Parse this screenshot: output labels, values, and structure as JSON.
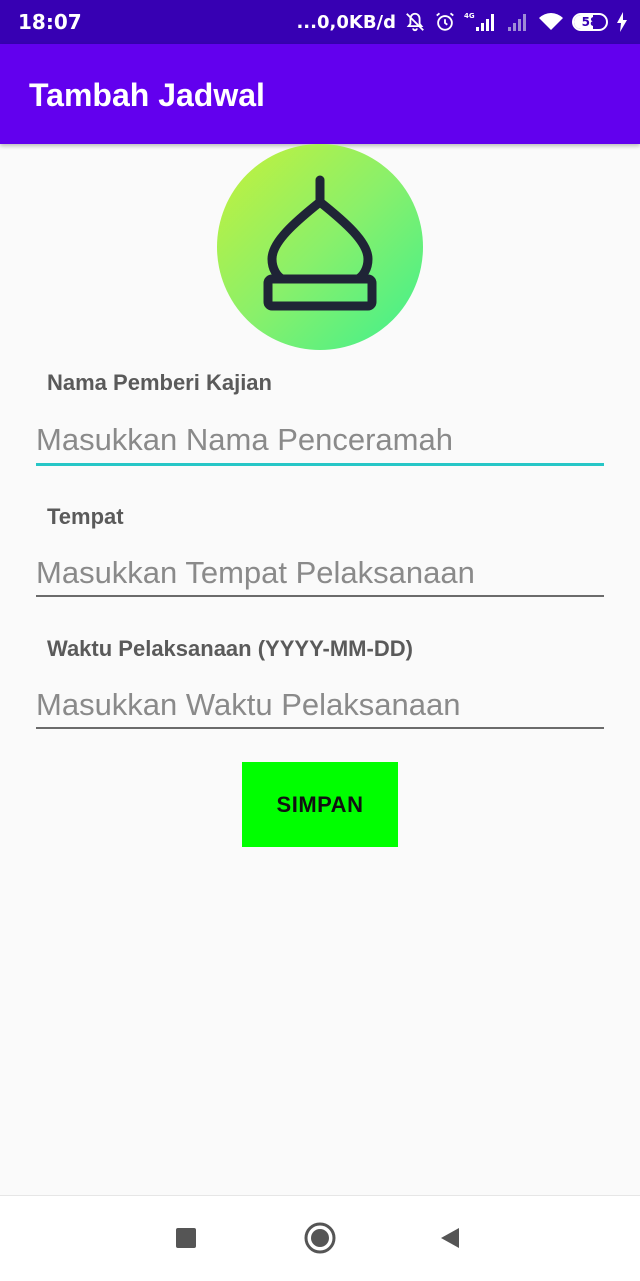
{
  "status_bar": {
    "time": "18:07",
    "network_speed": "...0,0KB/d",
    "battery_level": 58,
    "battery_text": "58",
    "icons": [
      "bell-off-icon",
      "alarm-icon",
      "signal-4g-icon",
      "signal-empty-icon",
      "wifi-icon",
      "battery-icon",
      "charging-icon"
    ]
  },
  "app_bar": {
    "title": "Tambah Jadwal",
    "color": "#6200ee"
  },
  "logo": {
    "icon": "mosque-dome-icon"
  },
  "form": {
    "fields": [
      {
        "label": "Nama Pemberi Kajian",
        "placeholder": "Masukkan Nama Penceramah",
        "value": ""
      },
      {
        "label": "Tempat",
        "placeholder": "Masukkan Tempat Pelaksanaan",
        "value": ""
      },
      {
        "label": "Waktu Pelaksanaan (YYYY-MM-DD)",
        "placeholder": "Masukkan Waktu Pelaksanaan",
        "value": ""
      }
    ],
    "submit_label": "SIMPAN",
    "focus_color": "#26c6c6",
    "button_color": "#00ff00"
  },
  "nav_bar": {
    "recents_icon": "square-icon",
    "home_icon": "circle-icon",
    "back_icon": "triangle-back-icon"
  }
}
